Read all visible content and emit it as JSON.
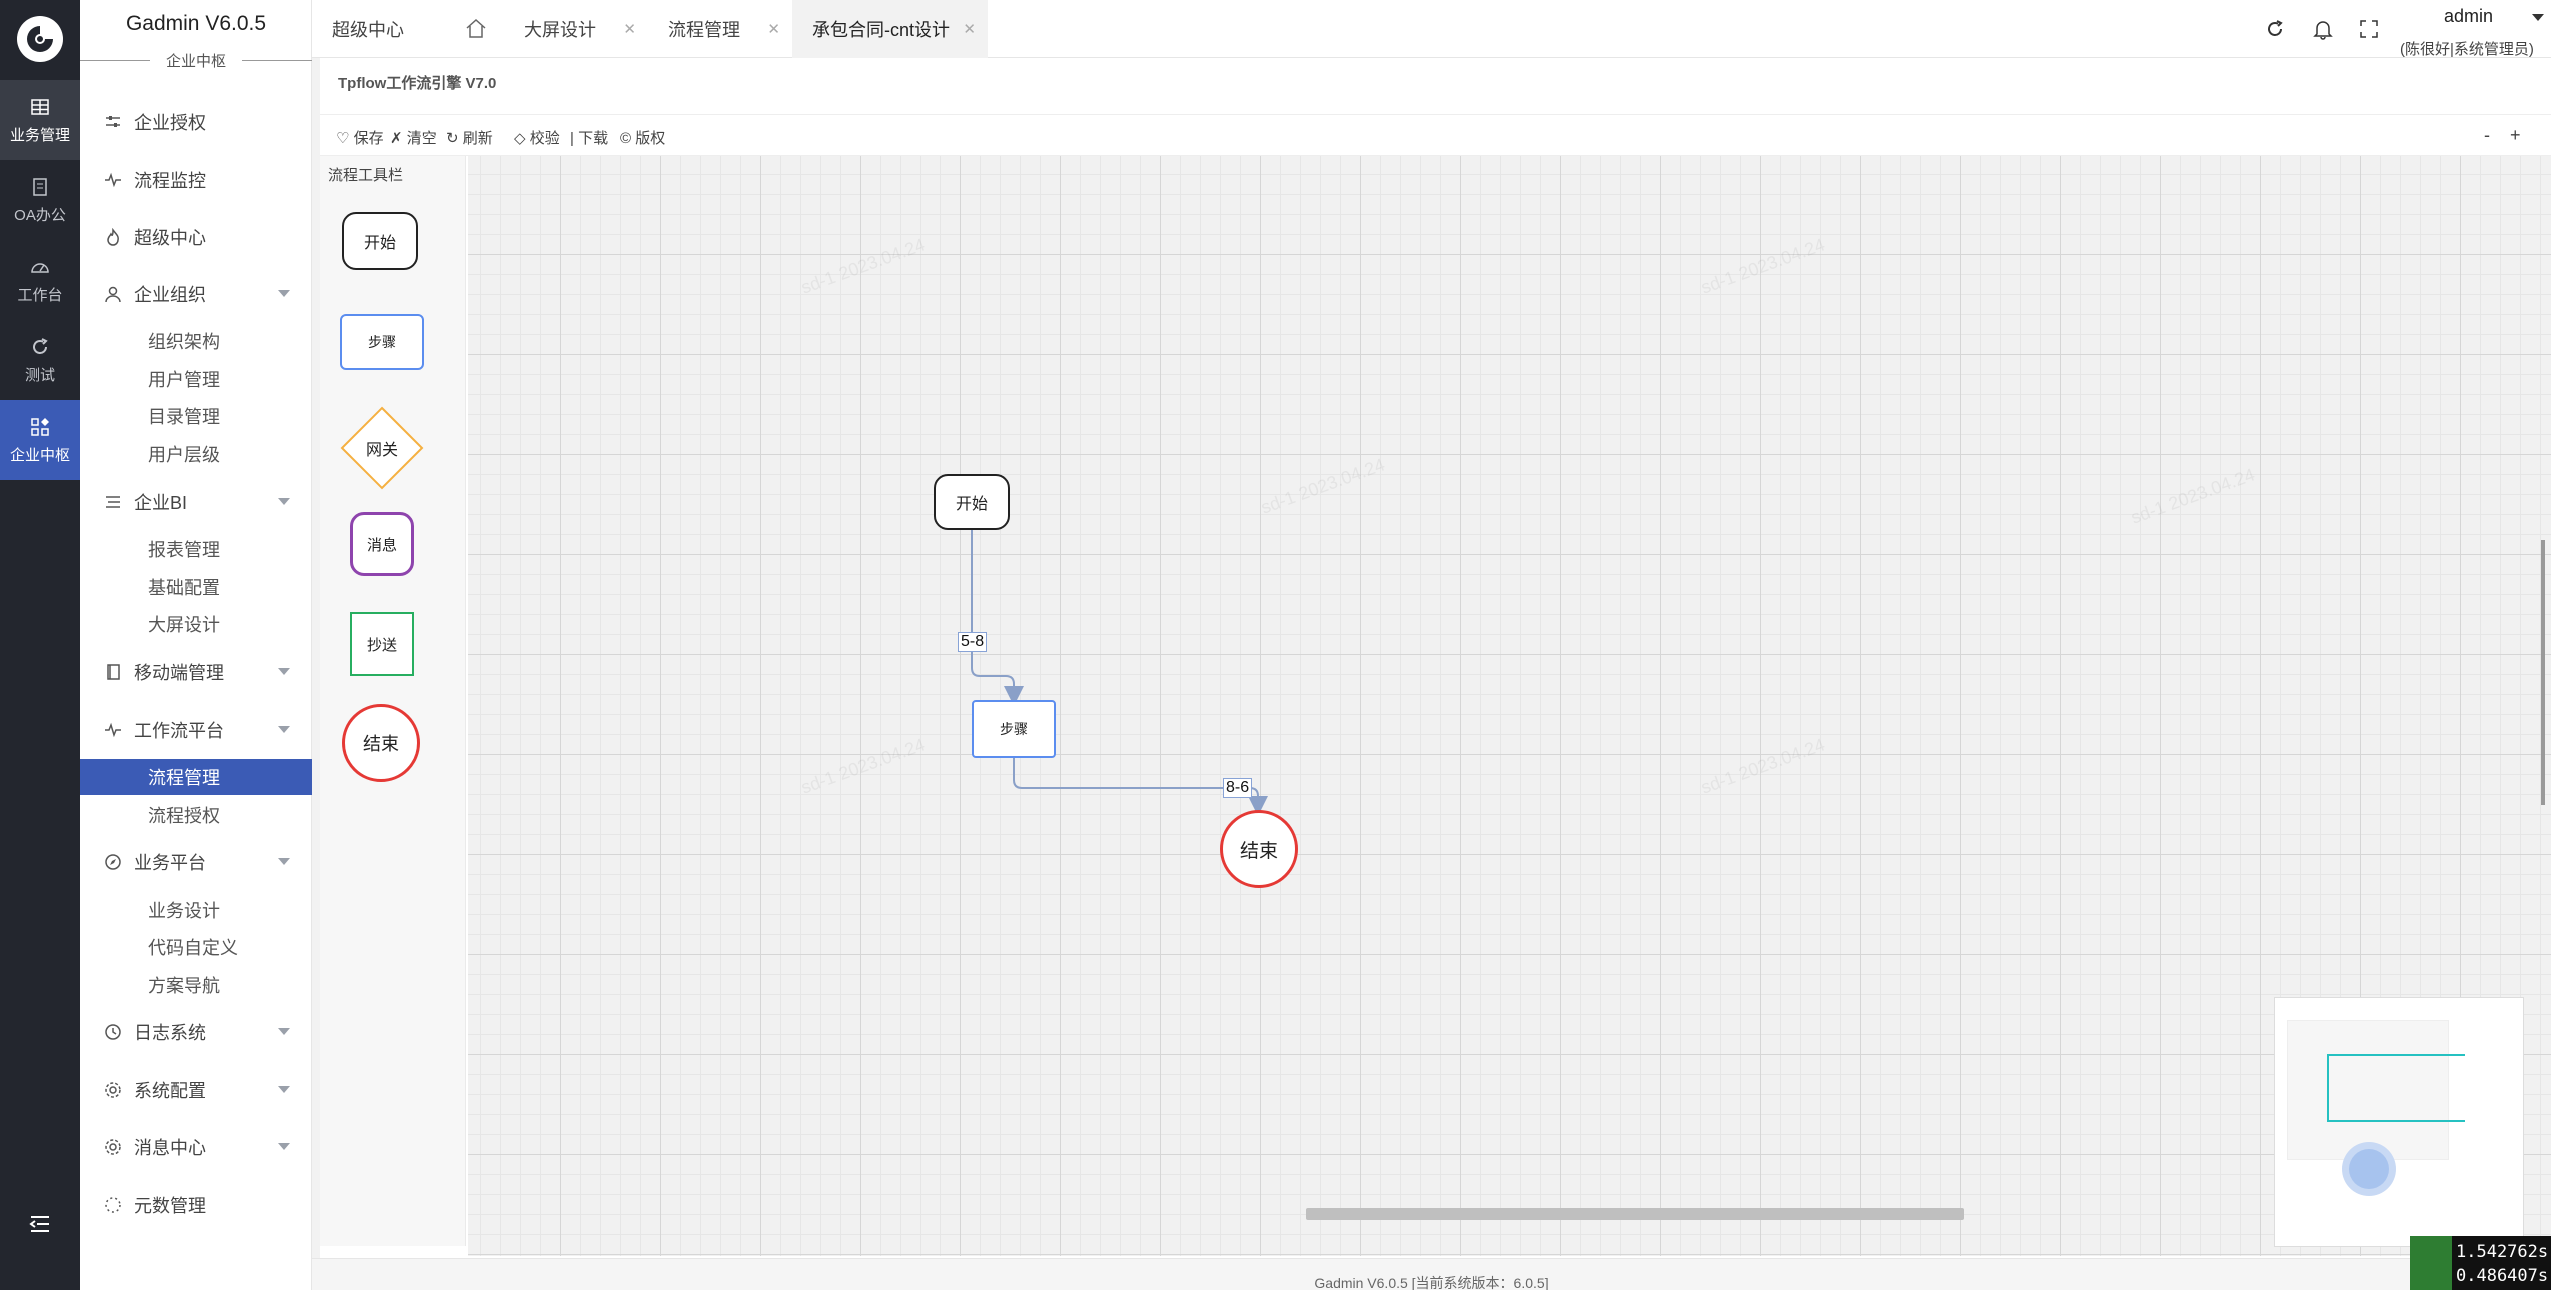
{
  "rail": {
    "items": [
      {
        "label": "业务管理"
      },
      {
        "label": "OA办公"
      },
      {
        "label": "工作台"
      },
      {
        "label": "测试"
      },
      {
        "label": "企业中枢"
      }
    ]
  },
  "sidebar": {
    "brand": "Gadmin V6.0.5",
    "brand_sub": "企业中枢",
    "groups": [
      {
        "label": "企业授权"
      },
      {
        "label": "流程监控"
      },
      {
        "label": "超级中心"
      },
      {
        "label": "企业组织",
        "children": [
          "组织架构",
          "用户管理",
          "目录管理",
          "用户层级"
        ]
      },
      {
        "label": "企业BI",
        "children": [
          "报表管理",
          "基础配置",
          "大屏设计"
        ]
      },
      {
        "label": "移动端管理"
      },
      {
        "label": "工作流平台",
        "children": [
          "流程管理",
          "流程授权"
        ]
      },
      {
        "label": "业务平台",
        "children": [
          "业务设计",
          "代码自定义",
          "方案导航"
        ]
      },
      {
        "label": "日志系统"
      },
      {
        "label": "系统配置"
      },
      {
        "label": "消息中心"
      },
      {
        "label": "元数管理"
      }
    ]
  },
  "tabs": [
    {
      "label": "超级中心"
    },
    {
      "label": "大屏设计"
    },
    {
      "label": "流程管理"
    },
    {
      "label": "承包合同-cnt设计"
    }
  ],
  "user": {
    "name": "admin",
    "role": "(陈很好|系统管理员)"
  },
  "designer": {
    "engine_title": "Tpflow工作流引擎 V7.0",
    "toolbar": {
      "save": "♡ 保存",
      "clear": "✗ 清空",
      "refresh": "↻ 刷新",
      "validate": "◇ 校验",
      "download": "| 下载",
      "copyright": "© 版权",
      "zoom_out": "-",
      "zoom_in": "+"
    },
    "palette": {
      "title": "流程工具栏",
      "items": [
        "开始",
        "步骤",
        "网关",
        "消息",
        "抄送",
        "结束"
      ]
    },
    "nodes": {
      "start": "开始",
      "step": "步骤",
      "end": "结束"
    },
    "edges": [
      "5-8",
      "8-6"
    ]
  },
  "footer": "Gadmin V6.0.5 [当前系统版本：6.0.5]",
  "perf": {
    "line1": "1.542762s",
    "line2": "0.486407s"
  },
  "watermark": "sd-1 2023.04.24",
  "colors": {
    "rail_bg": "#23262e",
    "accent": "#3b5bb5",
    "gateway": "#f5b041",
    "message": "#8e44ad",
    "copy": "#27ae60",
    "end": "#e53935"
  }
}
